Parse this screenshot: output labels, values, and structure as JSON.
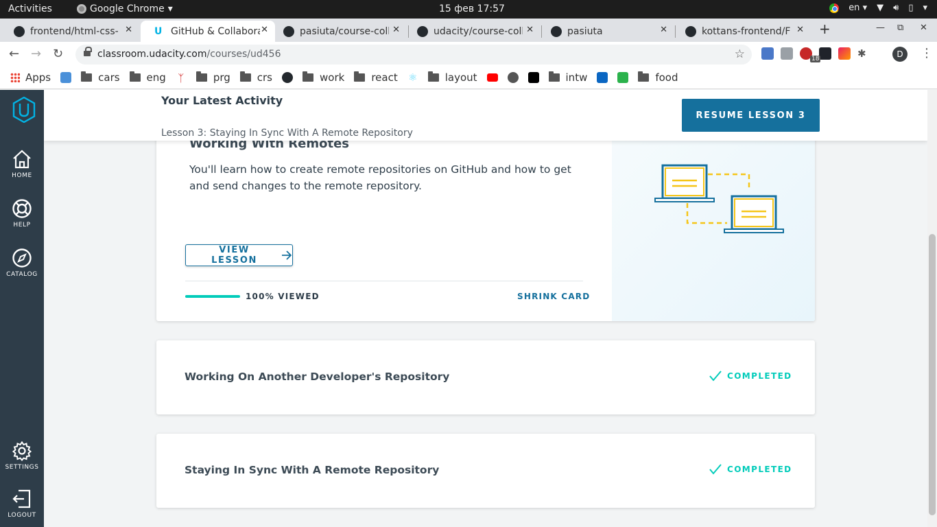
{
  "system_bar": {
    "activities": "Activities",
    "app_name": "Google Chrome",
    "clock": "15 фев  17:57",
    "language": "en"
  },
  "browser": {
    "tabs": [
      {
        "title": "frontend/html-css-",
        "icon": "github-icon",
        "active": false
      },
      {
        "title": "GitHub & Collabora",
        "icon": "udacity-icon",
        "active": true
      },
      {
        "title": "pasiuta/course-coll",
        "icon": "github-icon",
        "active": false
      },
      {
        "title": "udacity/course-coll",
        "icon": "github-icon",
        "active": false
      },
      {
        "title": "pasiuta",
        "icon": "github-icon",
        "active": false
      },
      {
        "title": "kottans-frontend/F",
        "icon": "github-icon",
        "active": false
      }
    ],
    "url_host": "classroom.udacity.com",
    "url_path": "/courses/ud456",
    "extension_badge": "18",
    "profile_initial": "D"
  },
  "bookmarks": [
    {
      "label": "Apps",
      "icon": "apps-grid-icon"
    },
    {
      "label": "",
      "icon": "star-ext-icon"
    },
    {
      "label": "cars",
      "icon": "folder-icon"
    },
    {
      "label": "eng",
      "icon": "folder-icon"
    },
    {
      "label": "",
      "icon": "person-icon"
    },
    {
      "label": "prg",
      "icon": "folder-icon"
    },
    {
      "label": "crs",
      "icon": "folder-icon"
    },
    {
      "label": "",
      "icon": "github-icon"
    },
    {
      "label": "work",
      "icon": "folder-icon"
    },
    {
      "label": "react",
      "icon": "folder-icon"
    },
    {
      "label": "",
      "icon": "react-icon"
    },
    {
      "label": "layout",
      "icon": "folder-icon"
    },
    {
      "label": "",
      "icon": "youtube-icon"
    },
    {
      "label": "",
      "icon": "globe-icon"
    },
    {
      "label": "",
      "icon": "dou-icon"
    },
    {
      "label": "intw",
      "icon": "folder-icon"
    },
    {
      "label": "",
      "icon": "linkedin-icon"
    },
    {
      "label": "",
      "icon": "feedly-icon"
    },
    {
      "label": "food",
      "icon": "folder-icon"
    }
  ],
  "sidebar": {
    "items": [
      {
        "label": "HOME",
        "icon": "home-icon"
      },
      {
        "label": "HELP",
        "icon": "lifebuoy-icon"
      },
      {
        "label": "CATALOG",
        "icon": "compass-icon"
      },
      {
        "label": "SETTINGS",
        "icon": "gear-icon"
      },
      {
        "label": "LOGOUT",
        "icon": "logout-icon"
      }
    ]
  },
  "activity": {
    "title": "Your Latest Activity",
    "subtitle": "Lesson 3: Staying In Sync With A Remote Repository",
    "resume_label": "RESUME LESSON 3"
  },
  "lesson_card": {
    "title": "Working With Remotes",
    "description": "You'll learn how to create remote repositories on GitHub and how to get and send changes to the remote repository.",
    "view_label": "VIEW LESSON",
    "progress_label": "100% VIEWED",
    "progress_fraction": 1.0,
    "shrink_label": "SHRINK CARD"
  },
  "completed_lessons": [
    {
      "title": "Working On Another Developer's Repository",
      "status": "COMPLETED"
    },
    {
      "title": "Staying In Sync With A Remote Repository",
      "status": "COMPLETED"
    }
  ],
  "colors": {
    "brand_blue": "#15709d",
    "sidebar": "#2e3d49",
    "success": "#02ccba",
    "accent_yellow": "#f5c518"
  }
}
